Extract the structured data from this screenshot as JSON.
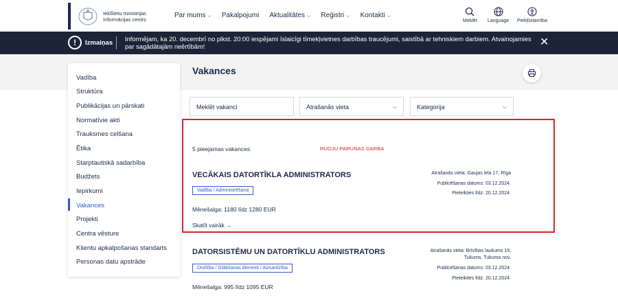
{
  "header": {
    "org_line1": "Iekšlietu ministrijas",
    "org_line2": "Informācijas centrs",
    "nav": [
      {
        "label": "Par mums",
        "dropdown": true
      },
      {
        "label": "Pakalpojumi",
        "dropdown": false
      },
      {
        "label": "Aktualitātes",
        "dropdown": true
      },
      {
        "label": "Reģistri",
        "dropdown": true
      },
      {
        "label": "Kontakti",
        "dropdown": true
      }
    ],
    "search_label": "Meklēt",
    "language_label": "Language",
    "accessibility_label": "Piekļūstamība"
  },
  "alert": {
    "title": "Izmaiņas",
    "message": "Informējam, ka 20. decembrī no plkst. 20:00 iespējami īslaicīgi tīmekļvietnes darbības traucējumi, saistībā ar tehniskiem darbiem. Atvainojamies par sagādātajām neērtībām!"
  },
  "sidebar": {
    "items": [
      {
        "label": "Vadība"
      },
      {
        "label": "Struktūra"
      },
      {
        "label": "Publikācijas un pārskati"
      },
      {
        "label": "Normatīvie akti"
      },
      {
        "label": "Trauksmes celšana"
      },
      {
        "label": "Ētika"
      },
      {
        "label": "Starptautiskā sadarbība"
      },
      {
        "label": "Budžets"
      },
      {
        "label": "Iepirkumi"
      },
      {
        "label": "Vakances"
      },
      {
        "label": "Projekti"
      },
      {
        "label": "Centra vēsture"
      },
      {
        "label": "Klientu apkalpošanas standarts"
      },
      {
        "label": "Personas datu apstrāde"
      }
    ],
    "active_index": 9
  },
  "main": {
    "title": "Vakances",
    "search_placeholder": "Meklēt vakanci",
    "location_select": "Atrašanās vieta",
    "category_select": "Kategorija",
    "count_text": "5 pieejamas vakances",
    "ruoju_text": "RUOJU PARUNAS DARBA",
    "jobs": [
      {
        "title": "VECĀKAIS DATORTĪKLA ADMINISTRATORS",
        "tag": "Vadība / Administrēšana",
        "salary": "Mēnešalga: 1180 līdz 1280 EUR",
        "more": "Skatīt vairāk",
        "location": "Atrašanās vieta:  Gaujas iela 17, Rīga",
        "published": "Publicēšanas datums: 03.12.2024.",
        "deadline": "Pieteikties līdz: 20.12.2024."
      },
      {
        "title": "DATORSISTĒMU UN DATORTĪKLU ADMINISTRATORS",
        "tag": "Drošība / Glābšanas dienesti / Aizsardzība",
        "salary": "Mēnešalga: 995 līdz 1095 EUR",
        "location_line1": "Atrašanās vieta:  Brīvības laukums 19,",
        "location_line2": "Tukums, Tukuma nov.",
        "published": "Publicēšanas datums: 03.12.2024.",
        "deadline": "Pieteikties līdz: 20.12.2024."
      }
    ]
  },
  "colors": {
    "navy": "#1b2a4a",
    "alert_bg": "#1c2438",
    "accent_blue": "#2f5cd0",
    "highlight_red": "#d8232a"
  }
}
